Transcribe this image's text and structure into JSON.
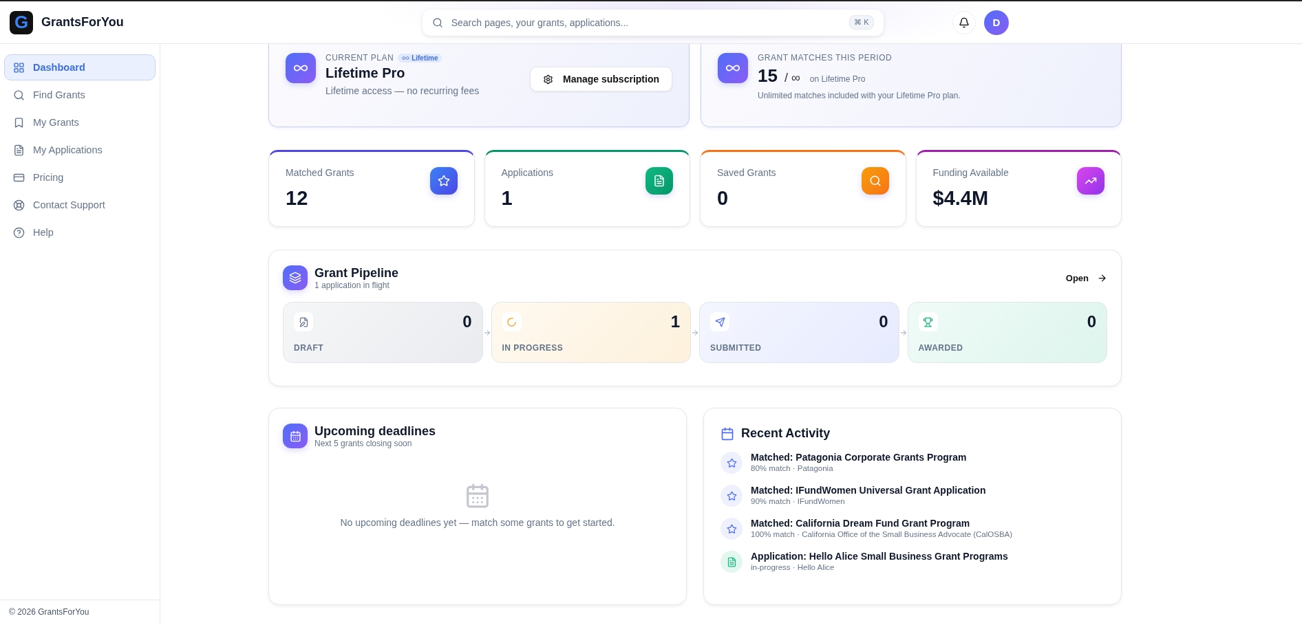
{
  "brand": {
    "logo_letter": "G",
    "name": "GrantsForYou"
  },
  "search": {
    "placeholder": "Search pages, your grants, applications...",
    "shortcut": "⌘ K"
  },
  "user": {
    "initial": "D"
  },
  "sidebar": {
    "items": [
      {
        "label": "Dashboard",
        "selected": true
      },
      {
        "label": "Find Grants",
        "selected": false
      },
      {
        "label": "My Grants",
        "selected": false
      },
      {
        "label": "My Applications",
        "selected": false
      },
      {
        "label": "Pricing",
        "selected": false
      },
      {
        "label": "Contact Support",
        "selected": false
      },
      {
        "label": "Help",
        "selected": false
      }
    ],
    "footer": "© 2026 GrantsForYou"
  },
  "plan": {
    "eyebrow": "CURRENT PLAN",
    "badge": "Lifetime",
    "name": "Lifetime Pro",
    "description": "Lifetime access — no recurring fees",
    "button": "Manage subscription"
  },
  "matches": {
    "eyebrow": "GRANT MATCHES THIS PERIOD",
    "count": "15",
    "limit": "/ ∞",
    "note": "on Lifetime Pro",
    "description": "Unlimited matches included with your Lifetime Pro plan."
  },
  "stats": [
    {
      "label": "Matched Grants",
      "value": "12",
      "color": "#4f46e5"
    },
    {
      "label": "Applications",
      "value": "1",
      "color": "#059669"
    },
    {
      "label": "Saved Grants",
      "value": "0",
      "color": "#f97316"
    },
    {
      "label": "Funding Available",
      "value": "$4.4M",
      "color": "#a21caf"
    }
  ],
  "pipeline": {
    "title": "Grant Pipeline",
    "subtitle": "1 application in flight",
    "link": "Open",
    "stages": [
      {
        "label": "DRAFT",
        "count": "0"
      },
      {
        "label": "IN PROGRESS",
        "count": "1"
      },
      {
        "label": "SUBMITTED",
        "count": "0"
      },
      {
        "label": "AWARDED",
        "count": "0"
      }
    ]
  },
  "deadlines": {
    "title": "Upcoming deadlines",
    "subtitle": "Next 5 grants closing soon",
    "empty": "No upcoming deadlines yet — match some grants to get started."
  },
  "activity": {
    "title": "Recent Activity",
    "items": [
      {
        "kind": "match",
        "title": "Matched: Patagonia Corporate Grants Program",
        "meta": "80% match · Patagonia"
      },
      {
        "kind": "match",
        "title": "Matched: IFundWomen Universal Grant Application",
        "meta": "90% match · IFundWomen"
      },
      {
        "kind": "match",
        "title": "Matched: California Dream Fund Grant Program",
        "meta": "100% match · California Office of the Small Business Advocate (CalOSBA)"
      },
      {
        "kind": "application",
        "title": "Application: Hello Alice Small Business Grant Programs",
        "meta": "in-progress · Hello Alice"
      }
    ]
  }
}
